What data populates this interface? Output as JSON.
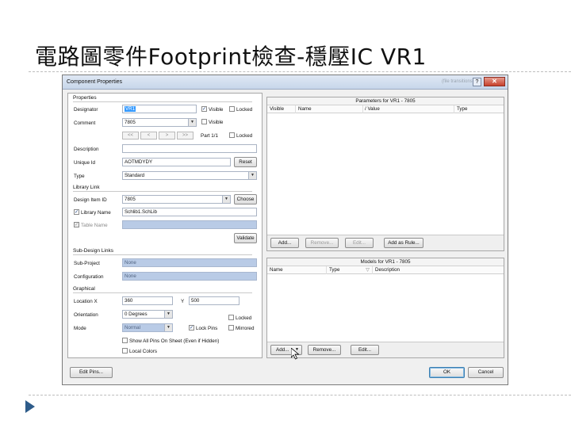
{
  "slide": {
    "title": "電路圖零件Footprint檢查-穩壓IC VR1"
  },
  "dialog": {
    "title": "Component Properties",
    "faded_text": "(file transitions)",
    "help_label": "?",
    "close_label": "✕",
    "properties": {
      "section": "Properties",
      "designator_label": "Designator",
      "designator_value": "VR1",
      "visible_label": "Visible",
      "locked_label": "Locked",
      "comment_label": "Comment",
      "comment_value": "7805",
      "comment_visible_label": "Visible",
      "nav_buttons": [
        "<<",
        "<",
        ">",
        ">>"
      ],
      "part_label": "Part 1/1",
      "part_locked_label": "Locked",
      "description_label": "Description",
      "description_value": "",
      "unique_id_label": "Unique Id",
      "unique_id_value": "AOTMDYDY",
      "reset_label": "Reset",
      "type_label": "Type",
      "type_value": "Standard"
    },
    "library_link": {
      "section": "Library Link",
      "design_item_label": "Design Item ID",
      "design_item_value": "7805",
      "choose_label": "Choose",
      "library_name_label": "Library Name",
      "library_name_value": "Schlib1.SchLib",
      "table_name_label": "Table Name",
      "validate_label": "Validate"
    },
    "sub_design": {
      "section": "Sub-Design Links",
      "sub_project_label": "Sub-Project",
      "sub_project_value": "None",
      "configuration_label": "Configuration",
      "configuration_value": "None"
    },
    "graphical": {
      "section": "Graphical",
      "location_label": "Location  X",
      "x_value": "360",
      "y_label": "Y",
      "y_value": "500",
      "orientation_label": "Orientation",
      "orientation_value": "0 Degrees",
      "locked_label": "Locked",
      "mode_label": "Mode",
      "mode_value": "Normal",
      "lock_pins_label": "Lock Pins",
      "mirrored_label": "Mirrored",
      "show_all_pins_label": "Show All Pins On Sheet (Even if Hidden)",
      "local_colors_label": "Local Colors"
    },
    "parameters": {
      "header": "Parameters for VR1 - 7805",
      "columns": [
        "Visible",
        "Name",
        "Value",
        "Type"
      ],
      "buttons": {
        "add": "Add...",
        "remove": "Remove...",
        "edit": "Edit...",
        "add_rule": "Add as Rule..."
      }
    },
    "models": {
      "header": "Models for VR1 - 7805",
      "columns": [
        "Name",
        "Type",
        "Description"
      ],
      "buttons": {
        "add": "Add...",
        "remove": "Remove...",
        "edit": "Edit..."
      }
    },
    "footer": {
      "edit_pins": "Edit Pins...",
      "ok": "OK",
      "cancel": "Cancel"
    }
  }
}
